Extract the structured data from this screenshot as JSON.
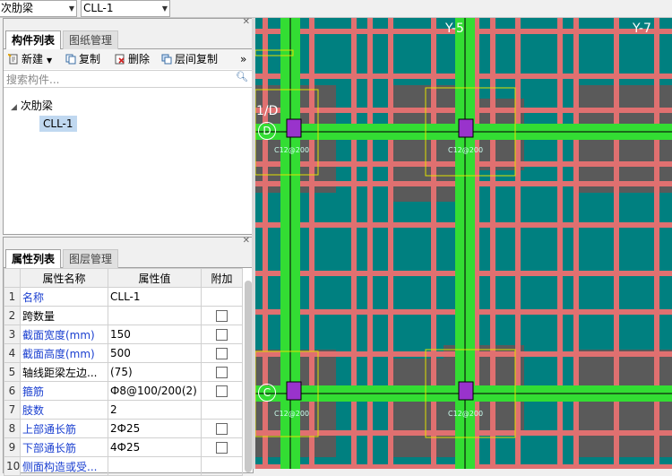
{
  "topbar": {
    "category_value": "次肋梁",
    "component_value": "CLL-1"
  },
  "component_panel": {
    "tabs": [
      "构件列表",
      "图纸管理"
    ],
    "toolbar": {
      "new_label": "新建",
      "copy_label": "复制",
      "delete_label": "删除",
      "floor_copy_label": "层间复制",
      "more_label": "»"
    },
    "search_placeholder": "搜索构件...",
    "tree": {
      "root_label": "次肋梁",
      "child_label": "CLL-1"
    }
  },
  "property_panel": {
    "tabs": [
      "属性列表",
      "图层管理"
    ],
    "headers": [
      "属性名称",
      "属性值",
      "附加"
    ],
    "rows": [
      {
        "num": "1",
        "name": "名称",
        "value": "CLL-1",
        "checkbox": false
      },
      {
        "num": "2",
        "name": "跨数量",
        "value": "",
        "checkbox": true
      },
      {
        "num": "3",
        "name": "截面宽度(mm)",
        "value": "150",
        "checkbox": true
      },
      {
        "num": "4",
        "name": "截面高度(mm)",
        "value": "500",
        "checkbox": true
      },
      {
        "num": "5",
        "name": "轴线距梁左边...",
        "value": "(75)",
        "checkbox": true
      },
      {
        "num": "6",
        "name": "箍筋",
        "value": "Ф8@100/200(2)",
        "checkbox": true
      },
      {
        "num": "7",
        "name": "肢数",
        "value": "2",
        "checkbox": false
      },
      {
        "num": "8",
        "name": "上部通长筋",
        "value": "2Ф25",
        "checkbox": true
      },
      {
        "num": "9",
        "name": "下部通长筋",
        "value": "4Ф25",
        "checkbox": true
      },
      {
        "num": "10",
        "name": "侧面构造或受...",
        "value": "",
        "checkbox": false
      }
    ]
  },
  "canvas": {
    "axis_labels": {
      "y5": "Y-5",
      "y7": "Y-7",
      "d1": "1/D",
      "d": "D",
      "c": "C"
    },
    "beam_labels": [
      "C12@200",
      "C12@200",
      "C12@200",
      "C12@200"
    ],
    "colors": {
      "background": "#008080",
      "red_grid": "#e07070",
      "green_beam": "#33dd33",
      "column": "#5a5a5a",
      "hatch": "#9933cc"
    }
  }
}
